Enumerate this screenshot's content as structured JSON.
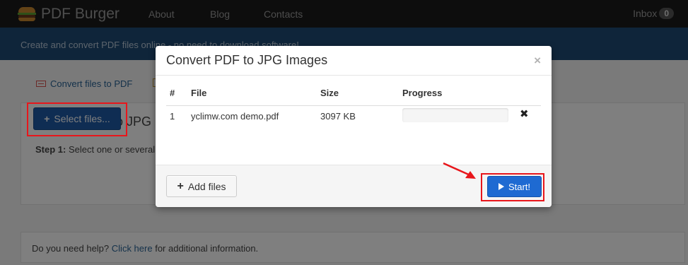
{
  "navbar": {
    "brand": "PDF Burger",
    "links": [
      "About",
      "Blog",
      "Contacts"
    ],
    "inbox_label": "Inbox",
    "inbox_count": "0"
  },
  "subheader": {
    "text": "Create and convert PDF files online - no need to download software!"
  },
  "page": {
    "tab_convert_files": "Convert files to PDF",
    "panel_title": "Convert PDF to JPG",
    "step_label": "Step 1:",
    "step_text": "Select one or several PDF files",
    "select_button": "Select files...",
    "help_text_before": "Do you need help?",
    "help_link": "Click here",
    "help_text_after": "for additional information."
  },
  "modal": {
    "title": "Convert PDF to JPG Images",
    "close_symbol": "×",
    "columns": [
      "#",
      "File",
      "Size",
      "Progress"
    ],
    "rows": [
      {
        "num": "1",
        "file": "yclimw.com demo.pdf",
        "size": "3097 KB",
        "progress": 0
      }
    ],
    "remove_symbol": "✖",
    "add_button": "Add files",
    "start_button": "Start!"
  },
  "colors": {
    "annotation_red": "#e8161b",
    "primary_blue": "#1e6ad2"
  }
}
